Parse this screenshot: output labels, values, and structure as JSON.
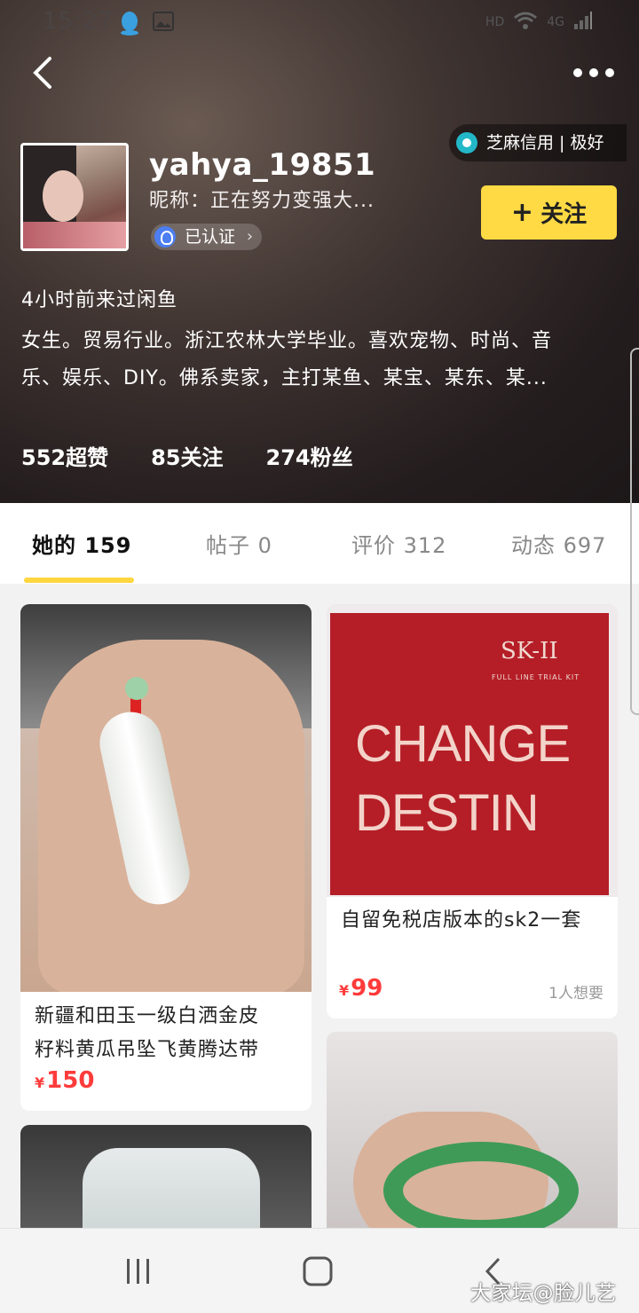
{
  "status_bar": {
    "time": "15:27",
    "hd": "HD",
    "network": "4G"
  },
  "profile": {
    "username": "yahya_19851",
    "nickname": "昵称：正在努力变强大...",
    "verified_label": "已认证",
    "credit_label": "芝麻信用 | 极好",
    "follow_label": "关注",
    "last_seen": "4小时前来过闲鱼",
    "bio_line1": "女生。贸易行业。浙江农林大学毕业。喜欢宠物、时尚、音",
    "bio_line2": "乐、娱乐、DIY。佛系卖家，主打某鱼、某宝、某东、某..."
  },
  "stats": [
    {
      "label": "552超赞"
    },
    {
      "label": "85关注"
    },
    {
      "label": "274粉丝"
    }
  ],
  "tabs": [
    {
      "label": "她的 159"
    },
    {
      "label": "帖子 0"
    },
    {
      "label": "评价 312"
    },
    {
      "label": "动态 697"
    }
  ],
  "listings": [
    {
      "title_line1": "新疆和田玉一级白洒金皮",
      "title_line2": "籽料黄瓜吊坠飞黄腾达带",
      "currency": "¥",
      "price": "150"
    },
    {
      "title": "自留免税店版本的sk2一套",
      "currency": "¥",
      "price": "99",
      "wants": "1人想要",
      "image_text": {
        "brand": "SK-II",
        "sub": "FULL LINE TRIAL KIT",
        "line1": "CHANGE",
        "line2": "DESTIN"
      }
    },
    {
      "image": "carved-jade-pendant"
    },
    {
      "image": "green-jade-bangle"
    }
  ],
  "watermark": "大家坛@脸儿艺",
  "colors": {
    "accent_yellow": "#ffda44",
    "price_red": "#ff3b3b",
    "header_dark": "#241d1e"
  }
}
